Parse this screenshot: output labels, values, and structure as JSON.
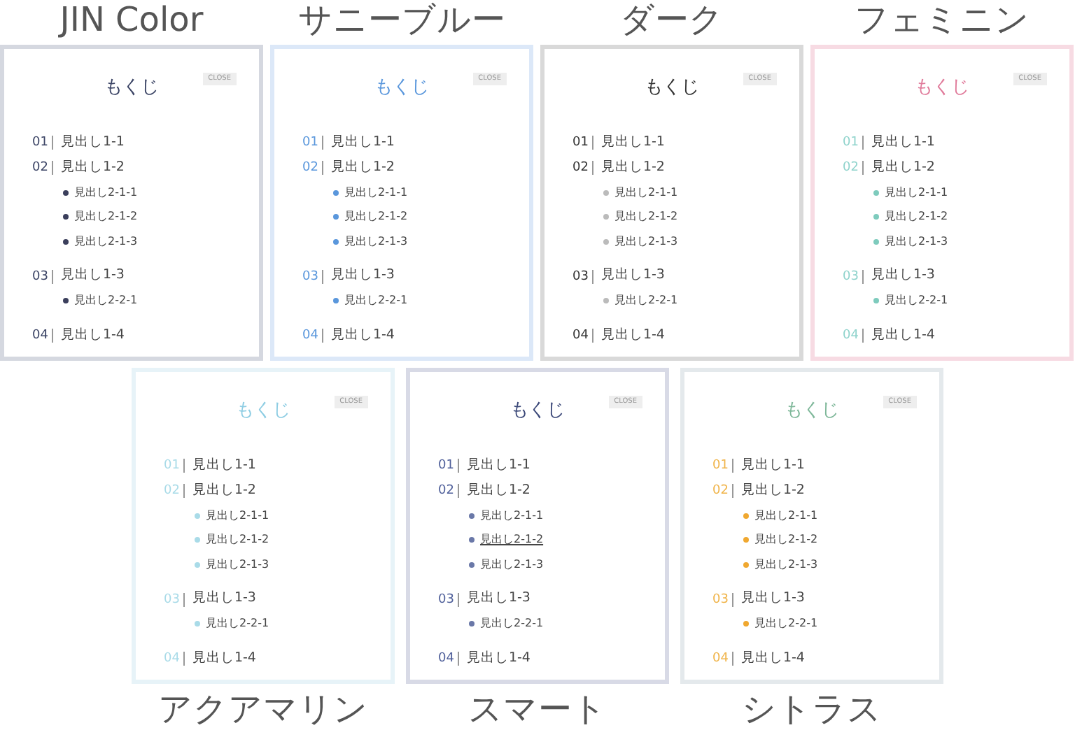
{
  "top_row": [
    {
      "name": "JIN Color",
      "color": "#d5d8e0",
      "heading": {
        "text": "もくじ",
        "color": "#3b4465"
      },
      "close": "CLOSE",
      "items": [
        {
          "number": "01",
          "label": "見出し1-1",
          "color": "#3b4465"
        },
        {
          "number": "02",
          "label": "見出し1-2",
          "color": "#3b4465",
          "children": [
            {
              "label": "見出し2-1-1",
              "underlined": false,
              "color": "#3b3f5c"
            },
            {
              "label": "見出し2-1-2",
              "underlined": false,
              "color": "#3b3f5c"
            },
            {
              "label": "見出し2-1-3",
              "underlined": false,
              "color": "#3b3f5c"
            }
          ]
        },
        {
          "number": "03",
          "label": "見出し1-3",
          "color": "#3b4465",
          "children": [
            {
              "label": "見出し2-2-1",
              "underlined": false,
              "color": "#3b3f5c"
            }
          ]
        },
        {
          "number": "04",
          "label": "見出し1-4",
          "color": "#3b4465"
        }
      ]
    },
    {
      "name": "サニーブルー",
      "color": "#dce8f8",
      "heading": {
        "text": "もくじ",
        "color": "#5a97dc"
      },
      "close": "CLOSE",
      "items": [
        {
          "number": "01",
          "label": "見出し1-1",
          "color": "#5a97dc"
        },
        {
          "number": "02",
          "label": "見出し1-2",
          "color": "#5a97dc",
          "children": [
            {
              "label": "見出し2-1-1",
              "underlined": false,
              "color": "#5a97dc"
            },
            {
              "label": "見出し2-1-2",
              "underlined": false,
              "color": "#5a97dc"
            },
            {
              "label": "見出し2-1-3",
              "underlined": false,
              "color": "#5a97dc"
            }
          ]
        },
        {
          "number": "03",
          "label": "見出し1-3",
          "color": "#5a97dc",
          "children": [
            {
              "label": "見出し2-2-1",
              "underlined": false,
              "color": "#5a97dc"
            }
          ]
        },
        {
          "number": "04",
          "label": "見出し1-4",
          "color": "#5a97dc"
        }
      ]
    },
    {
      "name": "ダーク",
      "color": "#d9d9d9",
      "heading": {
        "text": "もくじ",
        "color": "#333333"
      },
      "close": "CLOSE",
      "items": [
        {
          "number": "01",
          "label": "見出し1-1",
          "color": "#333333"
        },
        {
          "number": "02",
          "label": "見出し1-2",
          "color": "#333333",
          "children": [
            {
              "label": "見出し2-1-1",
              "underlined": false,
              "color": "#bbbbbb"
            },
            {
              "label": "見出し2-1-2",
              "underlined": false,
              "color": "#bbbbbb"
            },
            {
              "label": "見出し2-1-3",
              "underlined": false,
              "color": "#bbbbbb"
            }
          ]
        },
        {
          "number": "03",
          "label": "見出し1-3",
          "color": "#333333",
          "children": [
            {
              "label": "見出し2-2-1",
              "underlined": false,
              "color": "#bbbbbb"
            }
          ]
        },
        {
          "number": "04",
          "label": "見出し1-4",
          "color": "#333333"
        }
      ]
    },
    {
      "name": "フェミニン",
      "color": "#f7dbe3",
      "heading": {
        "text": "もくじ",
        "color": "#e07a9a"
      },
      "close": "CLOSE",
      "items": [
        {
          "number": "01",
          "label": "見出し1-1",
          "color": "#8fd3cc"
        },
        {
          "number": "02",
          "label": "見出し1-2",
          "color": "#8fd3cc",
          "children": [
            {
              "label": "見出し2-1-1",
              "underlined": false,
              "color": "#7ecbbd"
            },
            {
              "label": "見出し2-1-2",
              "underlined": false,
              "color": "#7ecbbd"
            },
            {
              "label": "見出し2-1-3",
              "underlined": false,
              "color": "#7ecbbd"
            }
          ]
        },
        {
          "number": "03",
          "label": "見出し1-3",
          "color": "#8fd3cc",
          "children": [
            {
              "label": "見出し2-2-1",
              "underlined": false,
              "color": "#7ecbbd"
            }
          ]
        },
        {
          "number": "04",
          "label": "見出し1-4",
          "color": "#8fd3cc"
        }
      ]
    }
  ],
  "bottom_row": [
    {
      "name": "アクアマリン",
      "color": "#e7f3f8",
      "heading": {
        "text": "もくじ",
        "color": "#8ecde3"
      },
      "close": "CLOSE",
      "items": [
        {
          "number": "01",
          "label": "見出し1-1",
          "color": "#a9dbe8"
        },
        {
          "number": "02",
          "label": "見出し1-2",
          "color": "#a9dbe8",
          "children": [
            {
              "label": "見出し2-1-1",
              "underlined": false,
              "color": "#a9dbe8"
            },
            {
              "label": "見出し2-1-2",
              "underlined": false,
              "color": "#a9dbe8"
            },
            {
              "label": "見出し2-1-3",
              "underlined": false,
              "color": "#a9dbe8"
            }
          ]
        },
        {
          "number": "03",
          "label": "見出し1-3",
          "color": "#a9dbe8",
          "children": [
            {
              "label": "見出し2-2-1",
              "underlined": false,
              "color": "#a9dbe8"
            }
          ]
        },
        {
          "number": "04",
          "label": "見出し1-4",
          "color": "#a9dbe8"
        }
      ]
    },
    {
      "name": "スマート",
      "color": "#d8dae6",
      "heading": {
        "text": "もくじ",
        "color": "#3d4a7a"
      },
      "close": "CLOSE",
      "items": [
        {
          "number": "01",
          "label": "見出し1-1",
          "color": "#4f5f9a"
        },
        {
          "number": "02",
          "label": "見出し1-2",
          "color": "#4f5f9a",
          "children": [
            {
              "label": "見出し2-1-1",
              "underlined": false,
              "color": "#6a78a8"
            },
            {
              "label": "見出し2-1-2",
              "underlined": true,
              "color": "#6a78a8"
            },
            {
              "label": "見出し2-1-3",
              "underlined": false,
              "color": "#6a78a8"
            }
          ]
        },
        {
          "number": "03",
          "label": "見出し1-3",
          "color": "#4f5f9a",
          "children": [
            {
              "label": "見出し2-2-1",
              "underlined": false,
              "color": "#6a78a8"
            }
          ]
        },
        {
          "number": "04",
          "label": "見出し1-4",
          "color": "#4f5f9a"
        }
      ]
    },
    {
      "name": "シトラス",
      "color": "#e4e9ec",
      "heading": {
        "text": "もくじ",
        "color": "#7fb89a"
      },
      "close": "CLOSE",
      "items": [
        {
          "number": "01",
          "label": "見出し1-1",
          "color": "#f0b44a"
        },
        {
          "number": "02",
          "label": "見出し1-2",
          "color": "#f0b44a",
          "children": [
            {
              "label": "見出し2-1-1",
              "underlined": false,
              "color": "#f0a830"
            },
            {
              "label": "見出し2-1-2",
              "underlined": false,
              "color": "#f0a830"
            },
            {
              "label": "見出し2-1-3",
              "underlined": false,
              "color": "#f0a830"
            }
          ]
        },
        {
          "number": "03",
          "label": "見出し1-3",
          "color": "#f0b44a",
          "children": [
            {
              "label": "見出し2-2-1",
              "underlined": false,
              "color": "#f0a830"
            }
          ]
        },
        {
          "number": "04",
          "label": "見出し1-4",
          "color": "#f0b44a"
        }
      ]
    }
  ]
}
